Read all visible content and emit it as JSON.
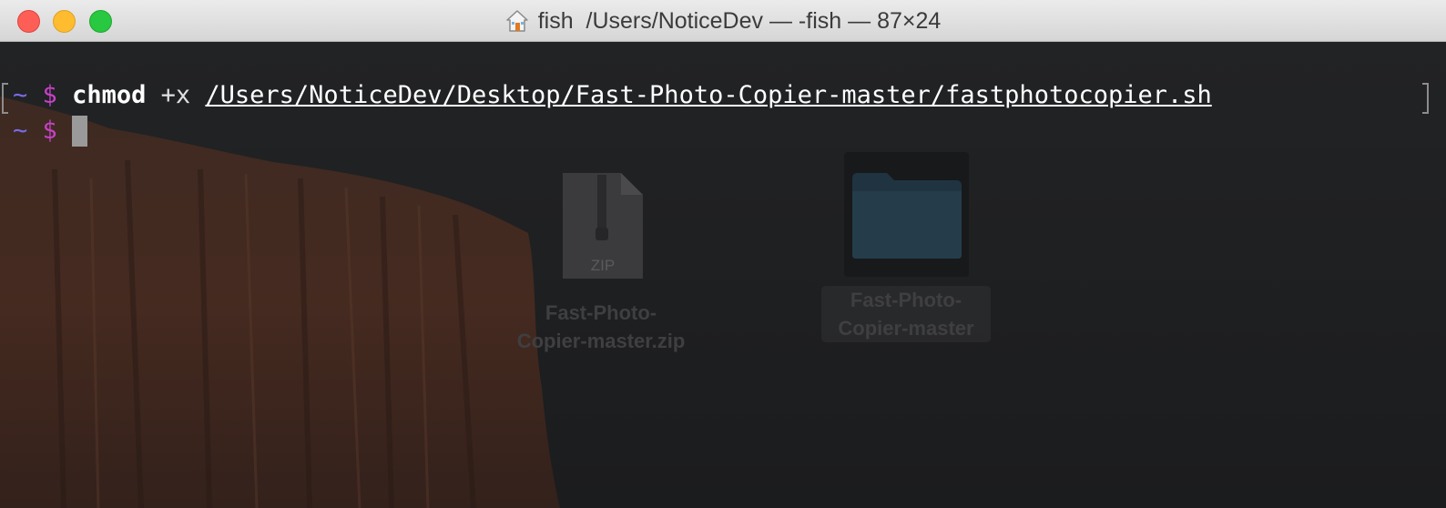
{
  "window": {
    "title_app": "fish",
    "title_path": "/Users/NoticeDev",
    "title_separator_1": " — ",
    "title_shell": "-fish",
    "title_separator_2": " — ",
    "title_size": "87×24"
  },
  "terminal": {
    "line1": {
      "tilde": "~",
      "prompt": "$",
      "command": "chmod",
      "argument": "+x",
      "path": "/Users/NoticeDev/Desktop/Fast-Photo-Copier-master/fastphotocopier.sh"
    },
    "line2": {
      "tilde": "~",
      "prompt": "$"
    }
  },
  "desktop": {
    "zip_file": {
      "badge": "ZIP",
      "label_line1": "Fast-Photo-",
      "label_line2": "Copier-master.zip"
    },
    "folder": {
      "label_line1": "Fast-Photo-",
      "label_line2": "Copier-master"
    }
  },
  "colors": {
    "tilde": "#7a6ae6",
    "prompt": "#c742c8",
    "cursor": "#9a9a9a"
  }
}
